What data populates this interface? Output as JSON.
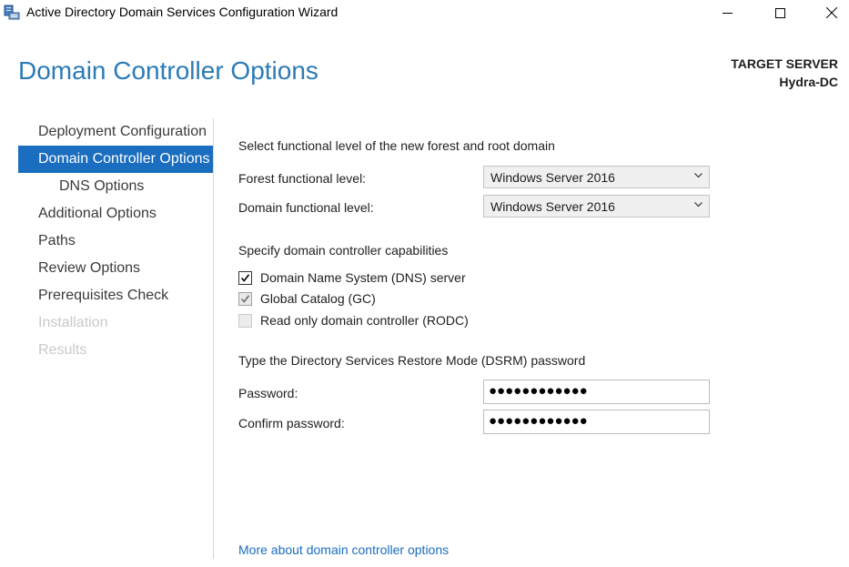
{
  "window": {
    "title": "Active Directory Domain Services Configuration Wizard",
    "controls": [
      "minimize-icon",
      "maximize-icon",
      "close-icon"
    ]
  },
  "header": {
    "page_title": "Domain Controller Options",
    "target_label": "TARGET SERVER",
    "target_name": "Hydra-DC"
  },
  "nav": {
    "items": [
      {
        "label": "Deployment Configuration",
        "state": "normal"
      },
      {
        "label": "Domain Controller Options",
        "state": "active"
      },
      {
        "label": "DNS Options",
        "state": "sub"
      },
      {
        "label": "Additional Options",
        "state": "normal"
      },
      {
        "label": "Paths",
        "state": "normal"
      },
      {
        "label": "Review Options",
        "state": "normal"
      },
      {
        "label": "Prerequisites Check",
        "state": "normal"
      },
      {
        "label": "Installation",
        "state": "disabled"
      },
      {
        "label": "Results",
        "state": "disabled"
      }
    ]
  },
  "functional_level": {
    "heading": "Select functional level of the new forest and root domain",
    "forest_label": "Forest functional level:",
    "forest_value": "Windows Server 2016",
    "domain_label": "Domain functional level:",
    "domain_value": "Windows Server 2016"
  },
  "capabilities": {
    "heading": "Specify domain controller capabilities",
    "dns": {
      "label": "Domain Name System (DNS) server",
      "checked": true
    },
    "gc": {
      "label": "Global Catalog (GC)",
      "checked": true,
      "disabled": true
    },
    "rodc": {
      "label": "Read only domain controller (RODC)",
      "checked": false,
      "disabled": true
    }
  },
  "dsrm": {
    "heading": "Type the Directory Services Restore Mode (DSRM) password",
    "password_label": "Password:",
    "password_value": "●●●●●●●●●●●●",
    "confirm_label": "Confirm password:",
    "confirm_value": "●●●●●●●●●●●●"
  },
  "more_link": "More about domain controller options",
  "colors": {
    "accent": "#1a6dbf",
    "heading": "#2b7bb5",
    "disabled_text": "#c9c9c9"
  }
}
